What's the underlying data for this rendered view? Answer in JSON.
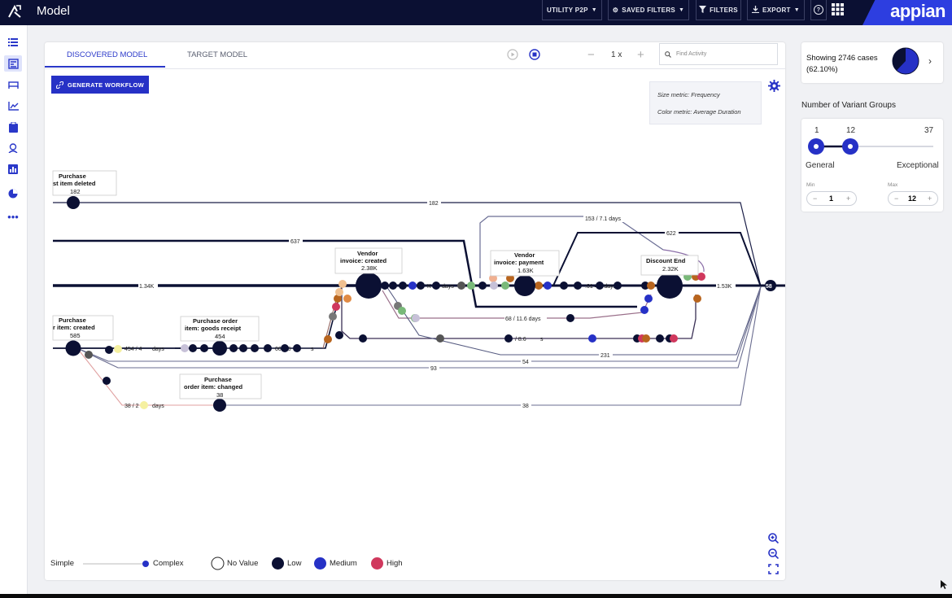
{
  "header": {
    "title": "Model",
    "brand": "appian",
    "buttons": {
      "utility": "UTILITY P2P",
      "saved_filters": "SAVED FILTERS",
      "filters": "FILTERS",
      "export": "EXPORT"
    }
  },
  "tabs": {
    "discovered": "DISCOVERED MODEL",
    "target": "TARGET MODEL"
  },
  "toolbar": {
    "zoom_value": "1 x",
    "find_placeholder": "Find Activity"
  },
  "generate_button": "GENERATE WORKFLOW",
  "metrics": {
    "size": "Size metric: Frequency",
    "color": "Color metric: Average Duration"
  },
  "graph": {
    "nodes": {
      "deleted_title1": "Purchase",
      "deleted_title2": "st item deleted",
      "deleted_count": "182",
      "created_title1": "Purchase",
      "created_title2": "r item: created",
      "created_count": "585",
      "goods_title1": "Purchase order",
      "goods_title2": "item: goods receipt",
      "goods_count": "454",
      "changed_title1": "Purchase",
      "changed_title2": "order item: changed",
      "changed_count": "38",
      "vinvoice_title1": "Vendor",
      "vinvoice_title2": "invoice: created",
      "vinvoice_count": "2.38K",
      "vpayment_title1": "Vendor",
      "vpayment_title2": "invoice: payment",
      "vpayment_count": "1.63K",
      "discount_title": "Discount End",
      "discount_count": "2.32K"
    },
    "edges": {
      "e182": "182",
      "e637": "637",
      "e134k": "1.34K",
      "e153": "153 / 7.1 days",
      "e622": "622",
      "e153k": "1.53K",
      "e454": "454 / 4",
      "e454days": "days",
      "e9_6": "00 9.6",
      "e9_6days": "s",
      "eKdays": "K / ",
      "eKdays2": "days",
      "e01": ".01 4.4 days",
      "e68": "68 / 11.6 days",
      "e8_6": "/ 8.6",
      "e8_6days": "s",
      "e231": "231",
      "e54": "54",
      "e93": "93",
      "e38a": "38 / 2",
      "e38adays": "days",
      "e38": "38",
      "end": "58"
    }
  },
  "legend": {
    "simple": "Simple",
    "complex": "Complex",
    "no_value": "No Value",
    "low": "Low",
    "medium": "Medium",
    "high": "High"
  },
  "right": {
    "cases_line1": "Showing 2746 cases",
    "cases_line2": "(62.10%)",
    "cases_fraction": 0.621,
    "variant_title": "Number of Variant Groups",
    "slider_min_label": "1",
    "slider_sel_label": "12",
    "slider_max_label": "37",
    "general": "General",
    "exceptional": "Exceptional",
    "min_caption": "Min",
    "max_caption": "Max",
    "min_value": "1",
    "max_value": "12"
  },
  "colors": {
    "nav": "#0b1033",
    "accent": "#2631c6",
    "low": "#0b1033",
    "medium": "#2631c6",
    "high": "#d0385d"
  }
}
